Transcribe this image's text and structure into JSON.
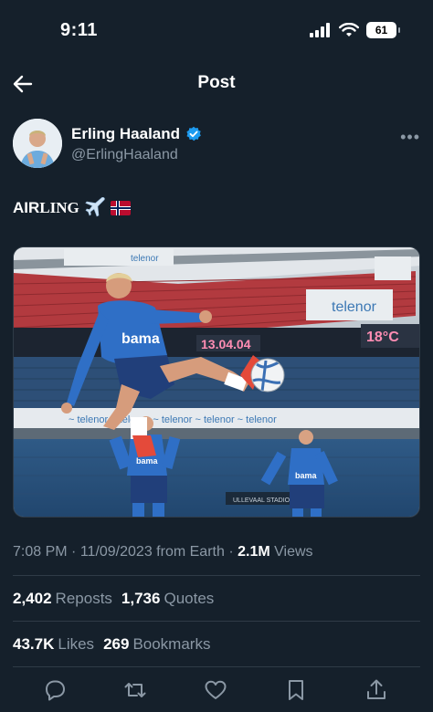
{
  "status_bar": {
    "time": "9:11",
    "battery": "61"
  },
  "nav": {
    "title": "Post"
  },
  "author": {
    "name": "Erling Haaland",
    "handle": "@ErlingHaaland"
  },
  "tweet": {
    "text_main": "AIR",
    "text_small": "LING",
    "emojis": "✈️🇳🇴"
  },
  "media": {
    "banner_big": "13.04.04",
    "temperature": "18°C",
    "sponsor": "bama",
    "sign_ad": "telenor",
    "stand_sign": "ULLEVAAL STADION"
  },
  "meta": {
    "time": "7:08 PM",
    "date": "11/09/2023",
    "source": "from Earth",
    "views_count": "2.1M",
    "views_label": "Views"
  },
  "stats": {
    "reposts": "2,402",
    "reposts_label": "Reposts",
    "quotes": "1,736",
    "quotes_label": "Quotes",
    "likes": "43.7K",
    "likes_label": "Likes",
    "bookmarks": "269",
    "bookmarks_label": "Bookmarks"
  },
  "colors": {
    "background": "#15202b",
    "secondary_text": "#8b98a5",
    "divider": "#2f3b47",
    "verified": "#1d9bf0"
  }
}
